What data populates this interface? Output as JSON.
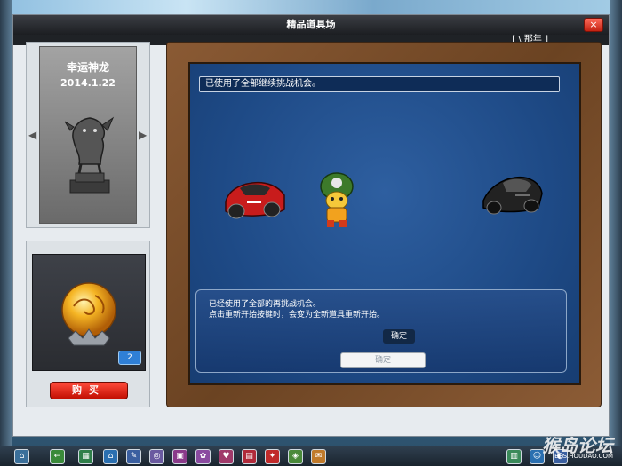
{
  "window": {
    "title": "精品道具场",
    "close_label": "×",
    "username": "[ \\ 那年 ]"
  },
  "showcase": {
    "item_name": "幸运神龙",
    "date": "2014.1.22",
    "prev_arrow": "◀",
    "next_arrow": "▶"
  },
  "item_panel": {
    "count": "2",
    "buy_label": "购买"
  },
  "board": {
    "top_message": "已使用了全部继续挑战机会。",
    "dialog": {
      "line1": "已经使用了全部的再挑战机会。",
      "line2": "点击重新开始按键时，会变为全新道具重新开始。",
      "confirm_dark": "确定",
      "confirm_light": "确定"
    }
  },
  "taskbar": {
    "icons": [
      "home-icon",
      "back-icon",
      "shop-icon",
      "house-icon",
      "tool-icon",
      "chat-icon",
      "gift-icon",
      "group-icon",
      "heart-icon",
      "book-icon",
      "party-icon",
      "photo-icon",
      "mail-icon",
      "note-icon",
      "user-icon",
      "skin-icon"
    ]
  },
  "watermark": {
    "text": "猴岛论坛",
    "url": "BBS.HOUDAO.COM"
  },
  "colors": {
    "title_bar": "#1c1e22",
    "board_blue": "#1e4a86",
    "wood": "#6b4322",
    "buy_red": "#c20f02"
  }
}
